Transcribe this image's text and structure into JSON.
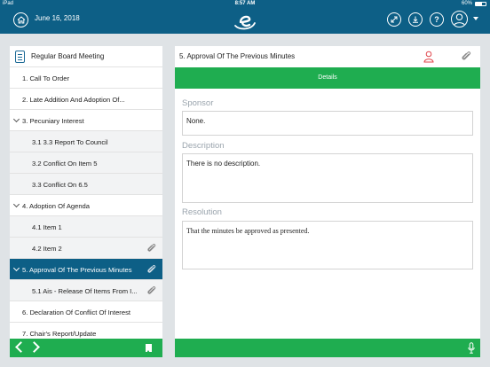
{
  "status_bar": {
    "device": "iPad",
    "time": "8:57 AM",
    "battery": "60%"
  },
  "header": {
    "date": "June 16, 2018",
    "help_label": "?"
  },
  "agenda": {
    "meeting_title": "Regular Board Meeting",
    "items": [
      {
        "label": "1. Call To Order"
      },
      {
        "label": "2. Late Addition And Adoption Of..."
      },
      {
        "label": "3. Pecuniary Interest"
      },
      {
        "label": "3.1 3.3 Report To Council"
      },
      {
        "label": "3.2 Conflict On Item 5"
      },
      {
        "label": "3.3 Conflict On 6.5"
      },
      {
        "label": "4. Adoption Of Agenda"
      },
      {
        "label": "4.1 Item 1"
      },
      {
        "label": "4.2 Item 2"
      },
      {
        "label": "5. Approval Of The Previous Minutes"
      },
      {
        "label": "5.1 Ais - Release Of Items From I..."
      },
      {
        "label": "6. Declaration Of Conflict Of Interest"
      },
      {
        "label": "7. Chair's Report/Update"
      }
    ]
  },
  "detail": {
    "title": "5. Approval Of The Previous Minutes",
    "tab_label": "Details",
    "sponsor_label": "Sponsor",
    "sponsor_value": "None.",
    "description_label": "Description",
    "description_value": "There is no description.",
    "resolution_label": "Resolution",
    "resolution_value": "That the minutes be approved as presented."
  },
  "colors": {
    "header": "#0d5f86",
    "accent_green": "#1fad50",
    "selected_row": "#0d5f86"
  }
}
